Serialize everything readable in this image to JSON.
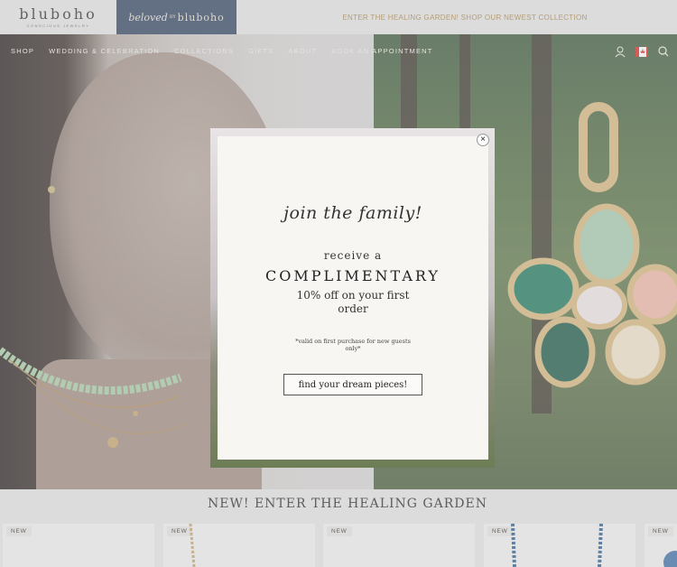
{
  "header": {
    "logo_text": "bluboho",
    "logo_subtext": "CONSCIOUS JEWELRY",
    "subbrand": {
      "prefix": "beloved",
      "by": "BY",
      "brand": "bluboho"
    },
    "announcement": "ENTER THE HEALING GARDEN! SHOP OUR NEWEST COLLECTION"
  },
  "nav": {
    "items": [
      {
        "label": "SHOP"
      },
      {
        "label": "WEDDING & CELEBRATION"
      },
      {
        "label": "COLLECTIONS"
      },
      {
        "label": "GIFTS"
      },
      {
        "label": "ABOUT"
      },
      {
        "label": "BOOK AN APPOINTMENT"
      }
    ],
    "icons": [
      "account-icon",
      "canada-flag-icon",
      "search-icon"
    ]
  },
  "modal": {
    "close_symbol": "×",
    "script_heading": "join the family!",
    "line1": "receive a",
    "line2": "COMPLIMENTARY",
    "line3": "10% off on your first order",
    "fine_print": "*valid on first purchase for new guests only*",
    "cta_label": "find your dream pieces!"
  },
  "section": {
    "title": "NEW! ENTER THE HEALING GARDEN",
    "cards": [
      {
        "badge": "NEW"
      },
      {
        "badge": "NEW"
      },
      {
        "badge": "NEW"
      },
      {
        "badge": "NEW"
      },
      {
        "badge": "NEW"
      }
    ]
  },
  "colors": {
    "brand_navy": "#34465f",
    "announcement_gold": "#a98a4e",
    "modal_bg": "#f8f6f3"
  }
}
